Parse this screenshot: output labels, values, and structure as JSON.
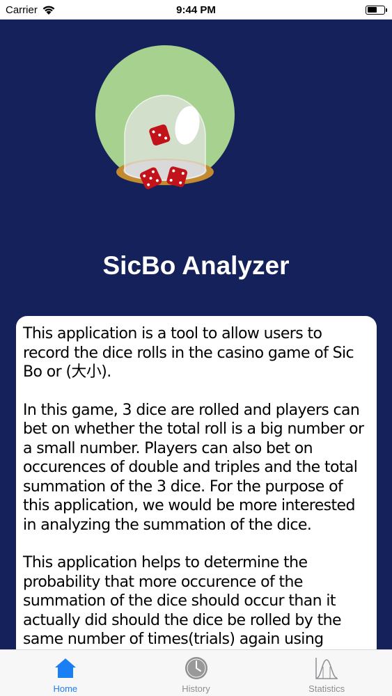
{
  "status_bar": {
    "carrier": "Carrier",
    "time": "9:44 PM",
    "battery_level": 0.6
  },
  "app": {
    "title": "SicBo Analyzer"
  },
  "description": {
    "paragraphs": [
      "This application is a tool to allow users to record the dice rolls in the casino game of Sic Bo or (大小).",
      "In this game, 3 dice are rolled and players can bet on whether the total roll is a big number or a small number. Players can also bet on occurences of double and triples and the total summation of the 3 dice. For the purpose of this application, we would be more interested in analyzing the summation of the dice.",
      "This application helps to determine the probability that more occurence of the summation of the dice should occur than it actually did should the dice be rolled by the same number of times(trials) again using"
    ]
  },
  "tabs": [
    {
      "label": "Home",
      "icon": "home-icon",
      "active": true
    },
    {
      "label": "History",
      "icon": "clock-icon",
      "active": false
    },
    {
      "label": "Statistics",
      "icon": "chart-icon",
      "active": false
    }
  ],
  "colors": {
    "background": "#15215a",
    "logo_circle": "#a6d18e",
    "dice": "#c2121a",
    "active_tab": "#1a7ff5",
    "inactive_tab": "#8e8e93"
  }
}
